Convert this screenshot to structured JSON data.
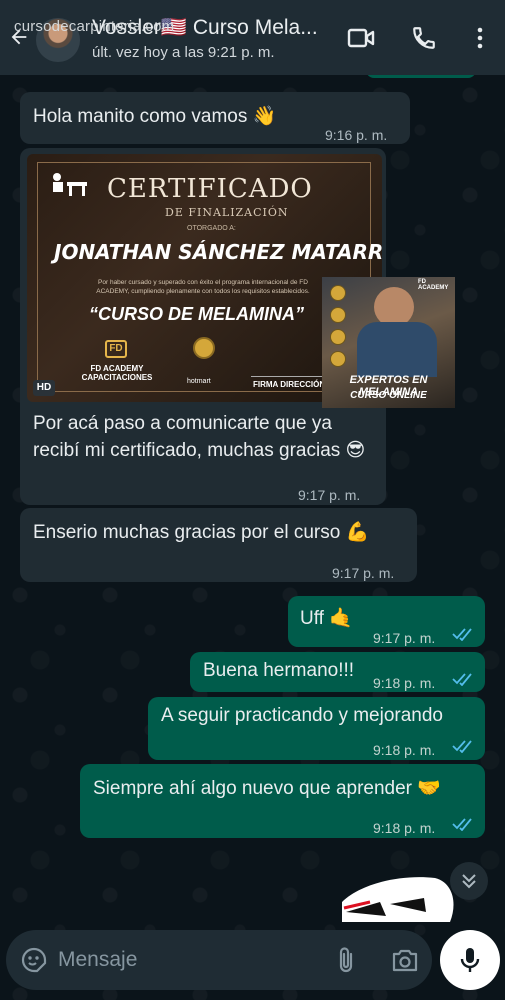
{
  "header": {
    "watermark": "cursodecarpinteria.com",
    "contact_name": "Vossler🇺🇸 Curso Mela...",
    "contact_status": "últ. vez hoy a las 9:21 p. m.",
    "icons": [
      "back-arrow-icon",
      "video-call-icon",
      "phone-icon",
      "more-vertical-icon"
    ]
  },
  "messages": [
    {
      "direction": "in",
      "text": "Hola manito como vamos 👋",
      "time": "9:16 p. m."
    },
    {
      "direction": "in",
      "type": "image",
      "image_badge": "HD",
      "text": "Por acá paso a comunicarte que ya recibí mi certificado, muchas gracias 😎",
      "time": "9:17 p. m."
    },
    {
      "direction": "in",
      "text": "Enserio muchas gracias por el curso 💪",
      "time": "9:17 p. m."
    },
    {
      "direction": "out",
      "text": "Uff 🤙",
      "time": "9:17 p. m.",
      "status": "read"
    },
    {
      "direction": "out",
      "text": "Buena hermano!!!",
      "time": "9:18 p. m.",
      "status": "read"
    },
    {
      "direction": "out",
      "text": "A seguir practicando y mejorando",
      "time": "9:18 p. m.",
      "status": "read"
    },
    {
      "direction": "out",
      "text": "Siempre ahí algo nuevo que aprender 🤝",
      "time": "9:18 p. m.",
      "status": "read"
    }
  ],
  "certificate": {
    "title": "CERTIFICADO",
    "subtitle": "DE FINALIZACIÓN",
    "awarded_to": "OTORGADO A:",
    "name": "JONATHAN SÁNCHEZ MATARRITA",
    "description": "Por haber cursado y superado con éxito el programa internacional de FD ACADEMY, cumpliendo plenamente con todos los requisitos establecidos.",
    "course": "“CURSO DE MELAMINA”",
    "fd_logo": "FD",
    "academy": "FD ACADEMY CAPACITACIONES",
    "hotmart": "hotmart",
    "signature": "FIRMA DIRECCIÓN"
  },
  "ad": {
    "top_label": "FD ACADEMY",
    "title": "EXPERTOS EN MELAMINA",
    "subtitle": "CURSO ONLINE"
  },
  "input": {
    "placeholder": "Mensaje"
  },
  "colors": {
    "background": "#0b141a",
    "header": "#1f2c34",
    "incoming_bubble": "#202c33",
    "outgoing_bubble": "#005c4b",
    "read_ticks": "#53bdeb"
  }
}
